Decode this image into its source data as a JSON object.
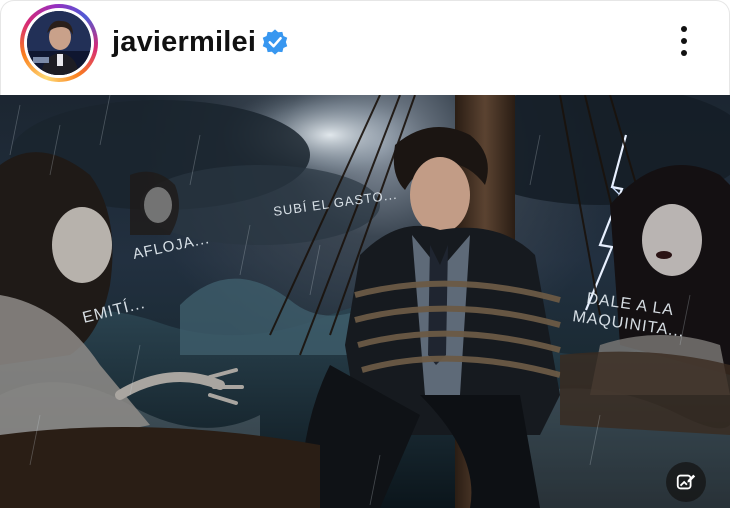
{
  "post": {
    "username": "javiermilei",
    "verified": true,
    "verified_icon": "verified-badge-icon",
    "menu_icon": "more-options-icon",
    "edit_icon": "edit-photo-icon",
    "colors": {
      "verified_blue": "#3897f0",
      "text": "#111111"
    }
  },
  "image": {
    "speech": {
      "afloja": "AFLOJA...",
      "emiti": "EMITÍ...",
      "subi_gasto": "SUBÍ EL GASTO...",
      "dale_1": "DALE A LA",
      "dale_2": "MAQUINITA..."
    }
  }
}
